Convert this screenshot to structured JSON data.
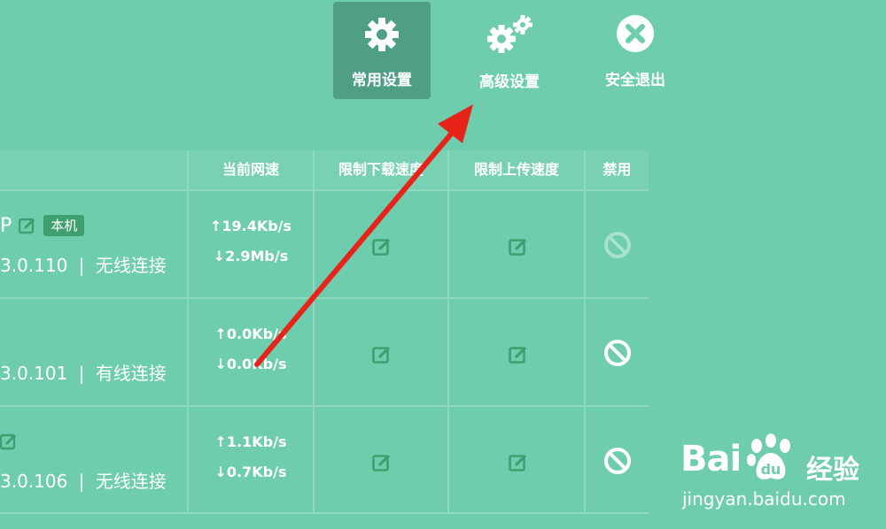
{
  "nav": {
    "items": [
      {
        "label": "常用设置",
        "icon": "gear-icon",
        "active": true
      },
      {
        "label": "高级设置",
        "icon": "gears-icon",
        "active": false
      },
      {
        "label": "安全退出",
        "icon": "close-circle-icon",
        "active": false
      }
    ]
  },
  "table": {
    "headers": {
      "speed": "当前网速",
      "download_limit": "限制下载速度",
      "upload_limit": "限制上传速度",
      "disable": "禁用"
    },
    "rows": [
      {
        "name": "P",
        "badge": "本机",
        "ip": "3.0.110",
        "sep": "|",
        "conn": "无线连接",
        "up": "↑19.4Kb/s",
        "down": "↓2.9Mb/s",
        "disable_state": "disabled-dimmed"
      },
      {
        "name": "",
        "badge": "",
        "ip": "3.0.101",
        "sep": "|",
        "conn": "有线连接",
        "up": "↑0.0Kb/s",
        "down": "↓0.0Kb/s",
        "disable_state": "enabled"
      },
      {
        "name": "",
        "badge": "",
        "ip": "3.0.106",
        "sep": "|",
        "conn": "无线连接",
        "up": "↑1.1Kb/s",
        "down": "↓0.7Kb/s",
        "disable_state": "enabled"
      }
    ]
  },
  "watermark": {
    "brand": "Bai",
    "brand_suffix": "经验",
    "url": "jingyan.baidu.com"
  },
  "colors": {
    "background": "#6ecdad",
    "active_tab": "#4f9e86",
    "badge": "#3f9f6e",
    "arrow": "#e8231a",
    "edit_icon": "#3f9f6e"
  }
}
